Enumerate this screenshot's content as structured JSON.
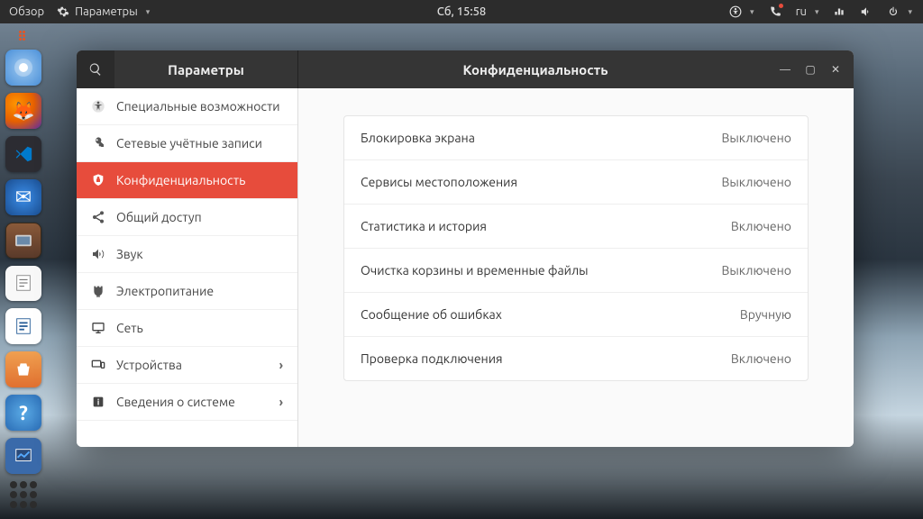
{
  "topbar": {
    "activities": "Обзор",
    "app_menu": "Параметры",
    "clock": "Сб, 15:58",
    "lang": "ru"
  },
  "window": {
    "sidebar_title": "Параметры",
    "content_title": "Конфиденциальность"
  },
  "sidebar": {
    "items": [
      {
        "icon": "accessibility",
        "label": "Специальные возможности",
        "active": false,
        "has_sub": false
      },
      {
        "icon": "online-accounts",
        "label": "Сетевые учётные записи",
        "active": false,
        "has_sub": false
      },
      {
        "icon": "privacy",
        "label": "Конфиденциальность",
        "active": true,
        "has_sub": false
      },
      {
        "icon": "sharing",
        "label": "Общий доступ",
        "active": false,
        "has_sub": false
      },
      {
        "icon": "sound",
        "label": "Звук",
        "active": false,
        "has_sub": false
      },
      {
        "icon": "power",
        "label": "Электропитание",
        "active": false,
        "has_sub": false
      },
      {
        "icon": "network",
        "label": "Сеть",
        "active": false,
        "has_sub": false
      },
      {
        "icon": "devices",
        "label": "Устройства",
        "active": false,
        "has_sub": true
      },
      {
        "icon": "details",
        "label": "Сведения о системе",
        "active": false,
        "has_sub": true
      }
    ]
  },
  "privacy_rows": [
    {
      "label": "Блокировка экрана",
      "value": "Выключено"
    },
    {
      "label": "Сервисы местоположения",
      "value": "Выключено"
    },
    {
      "label": "Статистика и история",
      "value": "Включено"
    },
    {
      "label": "Очистка корзины и временные файлы",
      "value": "Выключено"
    },
    {
      "label": "Сообщение об ошибках",
      "value": "Вручную"
    },
    {
      "label": "Проверка подключения",
      "value": "Включено"
    }
  ]
}
